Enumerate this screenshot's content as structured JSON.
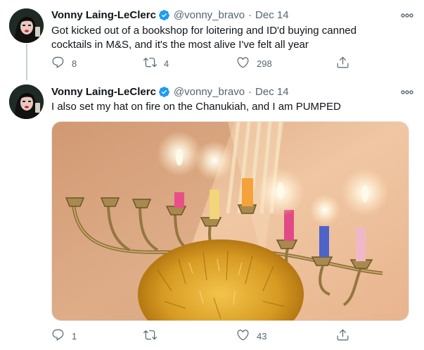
{
  "tweets": [
    {
      "author_name": "Vonny Laing-LeClerc",
      "handle": "@vonny_bravo",
      "separator": "·",
      "date": "Dec 14",
      "text_line1": "Got kicked out of a bookshop for loitering and ID'd buying canned",
      "text_line2": "cocktails in M&S, and it's the most alive I've felt all year",
      "reply_count": "8",
      "retweet_count": "4",
      "like_count": "298"
    },
    {
      "author_name": "Vonny Laing-LeClerc",
      "handle": "@vonny_bravo",
      "separator": "·",
      "date": "Dec 14",
      "text_line1": "I also set my hat on fire on the Chanukiah, and I am PUMPED",
      "reply_count": "1",
      "retweet_count": "",
      "like_count": "43"
    }
  ],
  "colors": {
    "text": "#0f1419",
    "secondary": "#536471",
    "verified": "#1d9bf0",
    "thread_line": "#c4cfd6"
  },
  "icons": [
    "verified-badge-icon",
    "more-icon",
    "reply-icon",
    "retweet-icon",
    "like-icon",
    "share-icon"
  ]
}
